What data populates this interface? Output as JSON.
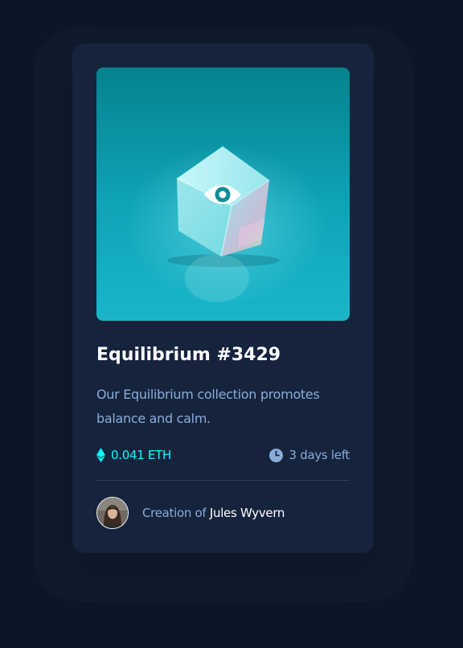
{
  "card": {
    "title": "Equilibrium #3429",
    "description": "Our Equilibrium collection promotes balance and calm.",
    "price": "0.041 ETH",
    "time_left": "3 days left",
    "creator_prefix": "Creation of",
    "creator_name": "Jules Wyvern"
  },
  "icons": {
    "image_overlay": "eye-icon",
    "price": "ethereum-icon",
    "time": "clock-icon"
  },
  "colors": {
    "page_background": "#0d1627",
    "card_background": "#15233d",
    "accent_cyan": "#00fff7",
    "muted_blue": "#8bacd9",
    "divider": "#2e405a",
    "white": "#ffffff"
  }
}
